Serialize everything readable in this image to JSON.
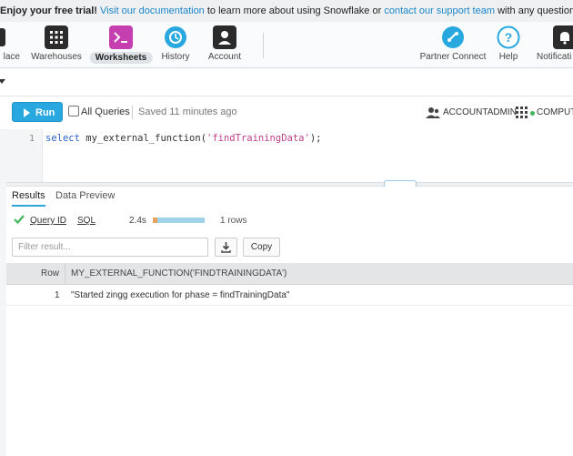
{
  "banner": {
    "lead": "Enjoy your free trial!",
    "link1": "Visit our documentation",
    "mid": "to learn more about using Snowflake or",
    "link2": "contact our support team",
    "tail": "with any questions."
  },
  "nav": {
    "items": [
      {
        "label": "lace",
        "icon": "marketplace-icon"
      },
      {
        "label": "Warehouses",
        "icon": "warehouses-icon"
      },
      {
        "label": "Worksheets",
        "icon": "worksheets-icon",
        "active": true
      },
      {
        "label": "History",
        "icon": "history-icon"
      },
      {
        "label": "Account",
        "icon": "account-icon"
      },
      {
        "label": "Partner Connect",
        "icon": "partner-connect-icon"
      },
      {
        "label": "Help",
        "icon": "help-icon"
      },
      {
        "label": "Notificati",
        "icon": "notifications-icon"
      }
    ]
  },
  "toolbar": {
    "run_label": "Run",
    "all_queries_label": "All Queries",
    "saved_text": "Saved 11 minutes ago",
    "role": "ACCOUNTADMIN",
    "warehouse": "COMPUT"
  },
  "editor": {
    "line_number": "1",
    "keyword": "select",
    "fn_open": " my_external_function(",
    "arg": "'findTrainingData'",
    "close": ");"
  },
  "results": {
    "tabs": [
      "Results",
      "Data Preview"
    ],
    "query_id_label": "Query ID",
    "sql_label": "SQL",
    "duration": "2.4s",
    "progress_fraction": 0.08,
    "rows_text": "1 rows",
    "filter_placeholder": "Filter result...",
    "copy_label": "Copy",
    "columns": [
      "Row",
      "MY_EXTERNAL_FUNCTION('FINDTRAININGDATA')"
    ],
    "rows": [
      {
        "index": "1",
        "value": "\"Started zingg execution for phase = findTrainingData\""
      }
    ]
  },
  "colors": {
    "accent": "#29a8e0",
    "success": "#3fb65a",
    "link": "#1a86c8"
  }
}
